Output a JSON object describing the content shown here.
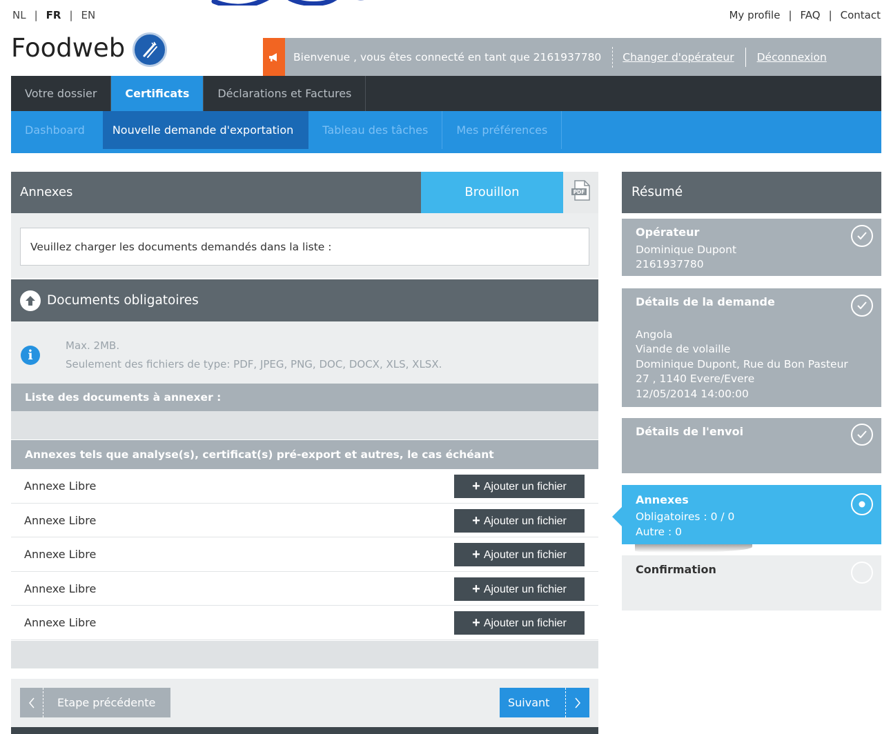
{
  "languages": [
    {
      "code": "NL",
      "active": false
    },
    {
      "code": "FR",
      "active": true
    },
    {
      "code": "EN",
      "active": false
    }
  ],
  "top_links": [
    "My profile",
    "FAQ",
    "Contact"
  ],
  "logo": {
    "text": "Foodweb",
    "icon": "fork-knife-icon"
  },
  "welcome": {
    "message": "Bienvenue , vous êtes connecté en tant que 2161937780",
    "change_operator": "Changer d'opérateur",
    "logout": "Déconnexion",
    "icon": "megaphone-icon"
  },
  "main_nav": [
    {
      "label": "Votre dossier",
      "active": false
    },
    {
      "label": "Certificats",
      "active": true
    },
    {
      "label": "Déclarations et Factures",
      "active": false
    }
  ],
  "sub_nav": [
    {
      "label": "Dashboard",
      "active": false
    },
    {
      "label": "Nouvelle demande d'exportation",
      "active": true
    },
    {
      "label": "Tableau des tâches",
      "active": false
    },
    {
      "label": "Mes préférences",
      "active": false
    }
  ],
  "annexes": {
    "title": "Annexes",
    "status": "Brouillon",
    "pdf_icon": "pdf-icon",
    "instruction": "Veuillez charger les documents demandés dans la liste :",
    "mandatory_title": "Documents obligatoires",
    "info_max": "Max. 2MB.",
    "info_types": "Seulement des fichiers de type: PDF, JPEG, PNG, DOC, DOCX, XLS, XLSX.",
    "list_header": "Liste des documents à annexer :",
    "annex_header": "Annexes tels que analyse(s), certificat(s) pré-export et autres, le cas échéant",
    "rows": [
      {
        "label": "Annexe Libre",
        "button": "Ajouter un fichier"
      },
      {
        "label": "Annexe Libre",
        "button": "Ajouter un fichier"
      },
      {
        "label": "Annexe Libre",
        "button": "Ajouter un fichier"
      },
      {
        "label": "Annexe Libre",
        "button": "Ajouter un fichier"
      },
      {
        "label": "Annexe Libre",
        "button": "Ajouter un fichier"
      }
    ],
    "prev_button": "Etape précédente",
    "next_button": "Suivant"
  },
  "summary": {
    "title": "Résumé",
    "operator": {
      "title": "Opérateur",
      "lines": [
        "Dominique Dupont",
        "2161937780"
      ],
      "state": "done"
    },
    "request": {
      "title": "Détails de la demande",
      "lines": [
        "Angola",
        "Viande de volaille",
        "Dominique Dupont, Rue du Bon Pasteur",
        "27 , 1140 Evere/Evere",
        "12/05/2014 14:00:00"
      ],
      "state": "done"
    },
    "shipment": {
      "title": "Détails de l'envoi",
      "state": "done"
    },
    "annexes": {
      "title": "Annexes",
      "lines": [
        "Obligatoires : 0 / 0",
        "Autre : 0"
      ],
      "state": "current"
    },
    "confirmation": {
      "title": "Confirmation",
      "state": "todo"
    }
  },
  "colors": {
    "accent": "#2592e0",
    "active_step": "#3fb6ec",
    "dark": "#5d676e",
    "orange": "#f26522"
  }
}
